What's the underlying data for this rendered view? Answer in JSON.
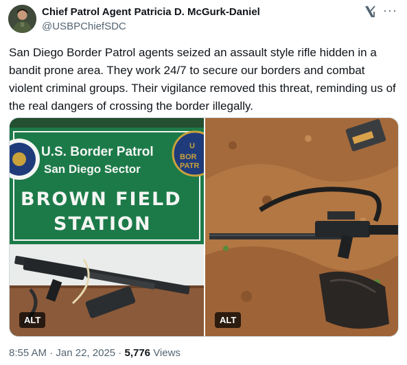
{
  "author": {
    "name": "Chief Patrol Agent Patricia D. McGurk-Daniel",
    "handle": "@USBPChiefSDC"
  },
  "tweet": {
    "text": "San Diego Border Patrol agents seized an assault style rifle hidden in a bandit prone area. They work 24/7 to secure our borders and combat violent criminal groups. Their vigilance removed this threat, reminding us of the real dangers of crossing the border illegally."
  },
  "media": {
    "left": {
      "sign_line1": "U.S. Border Patrol",
      "sign_line2": "San Diego Sector",
      "sign_line3": "BROWN FIELD",
      "sign_line4": "STATION",
      "alt": "ALT"
    },
    "right": {
      "alt": "ALT"
    }
  },
  "meta": {
    "time": "8:55 AM",
    "sep1": " · ",
    "date": "Jan 22, 2025",
    "sep2": " · ",
    "views_count": "5,776",
    "views_label": " Views"
  },
  "icons": {
    "logo": "x-logo-icon",
    "more": "more-icon"
  },
  "colors": {
    "sign_green": "#1c7a49",
    "sign_white": "#f4f6f3",
    "dirt": "#b27743"
  }
}
